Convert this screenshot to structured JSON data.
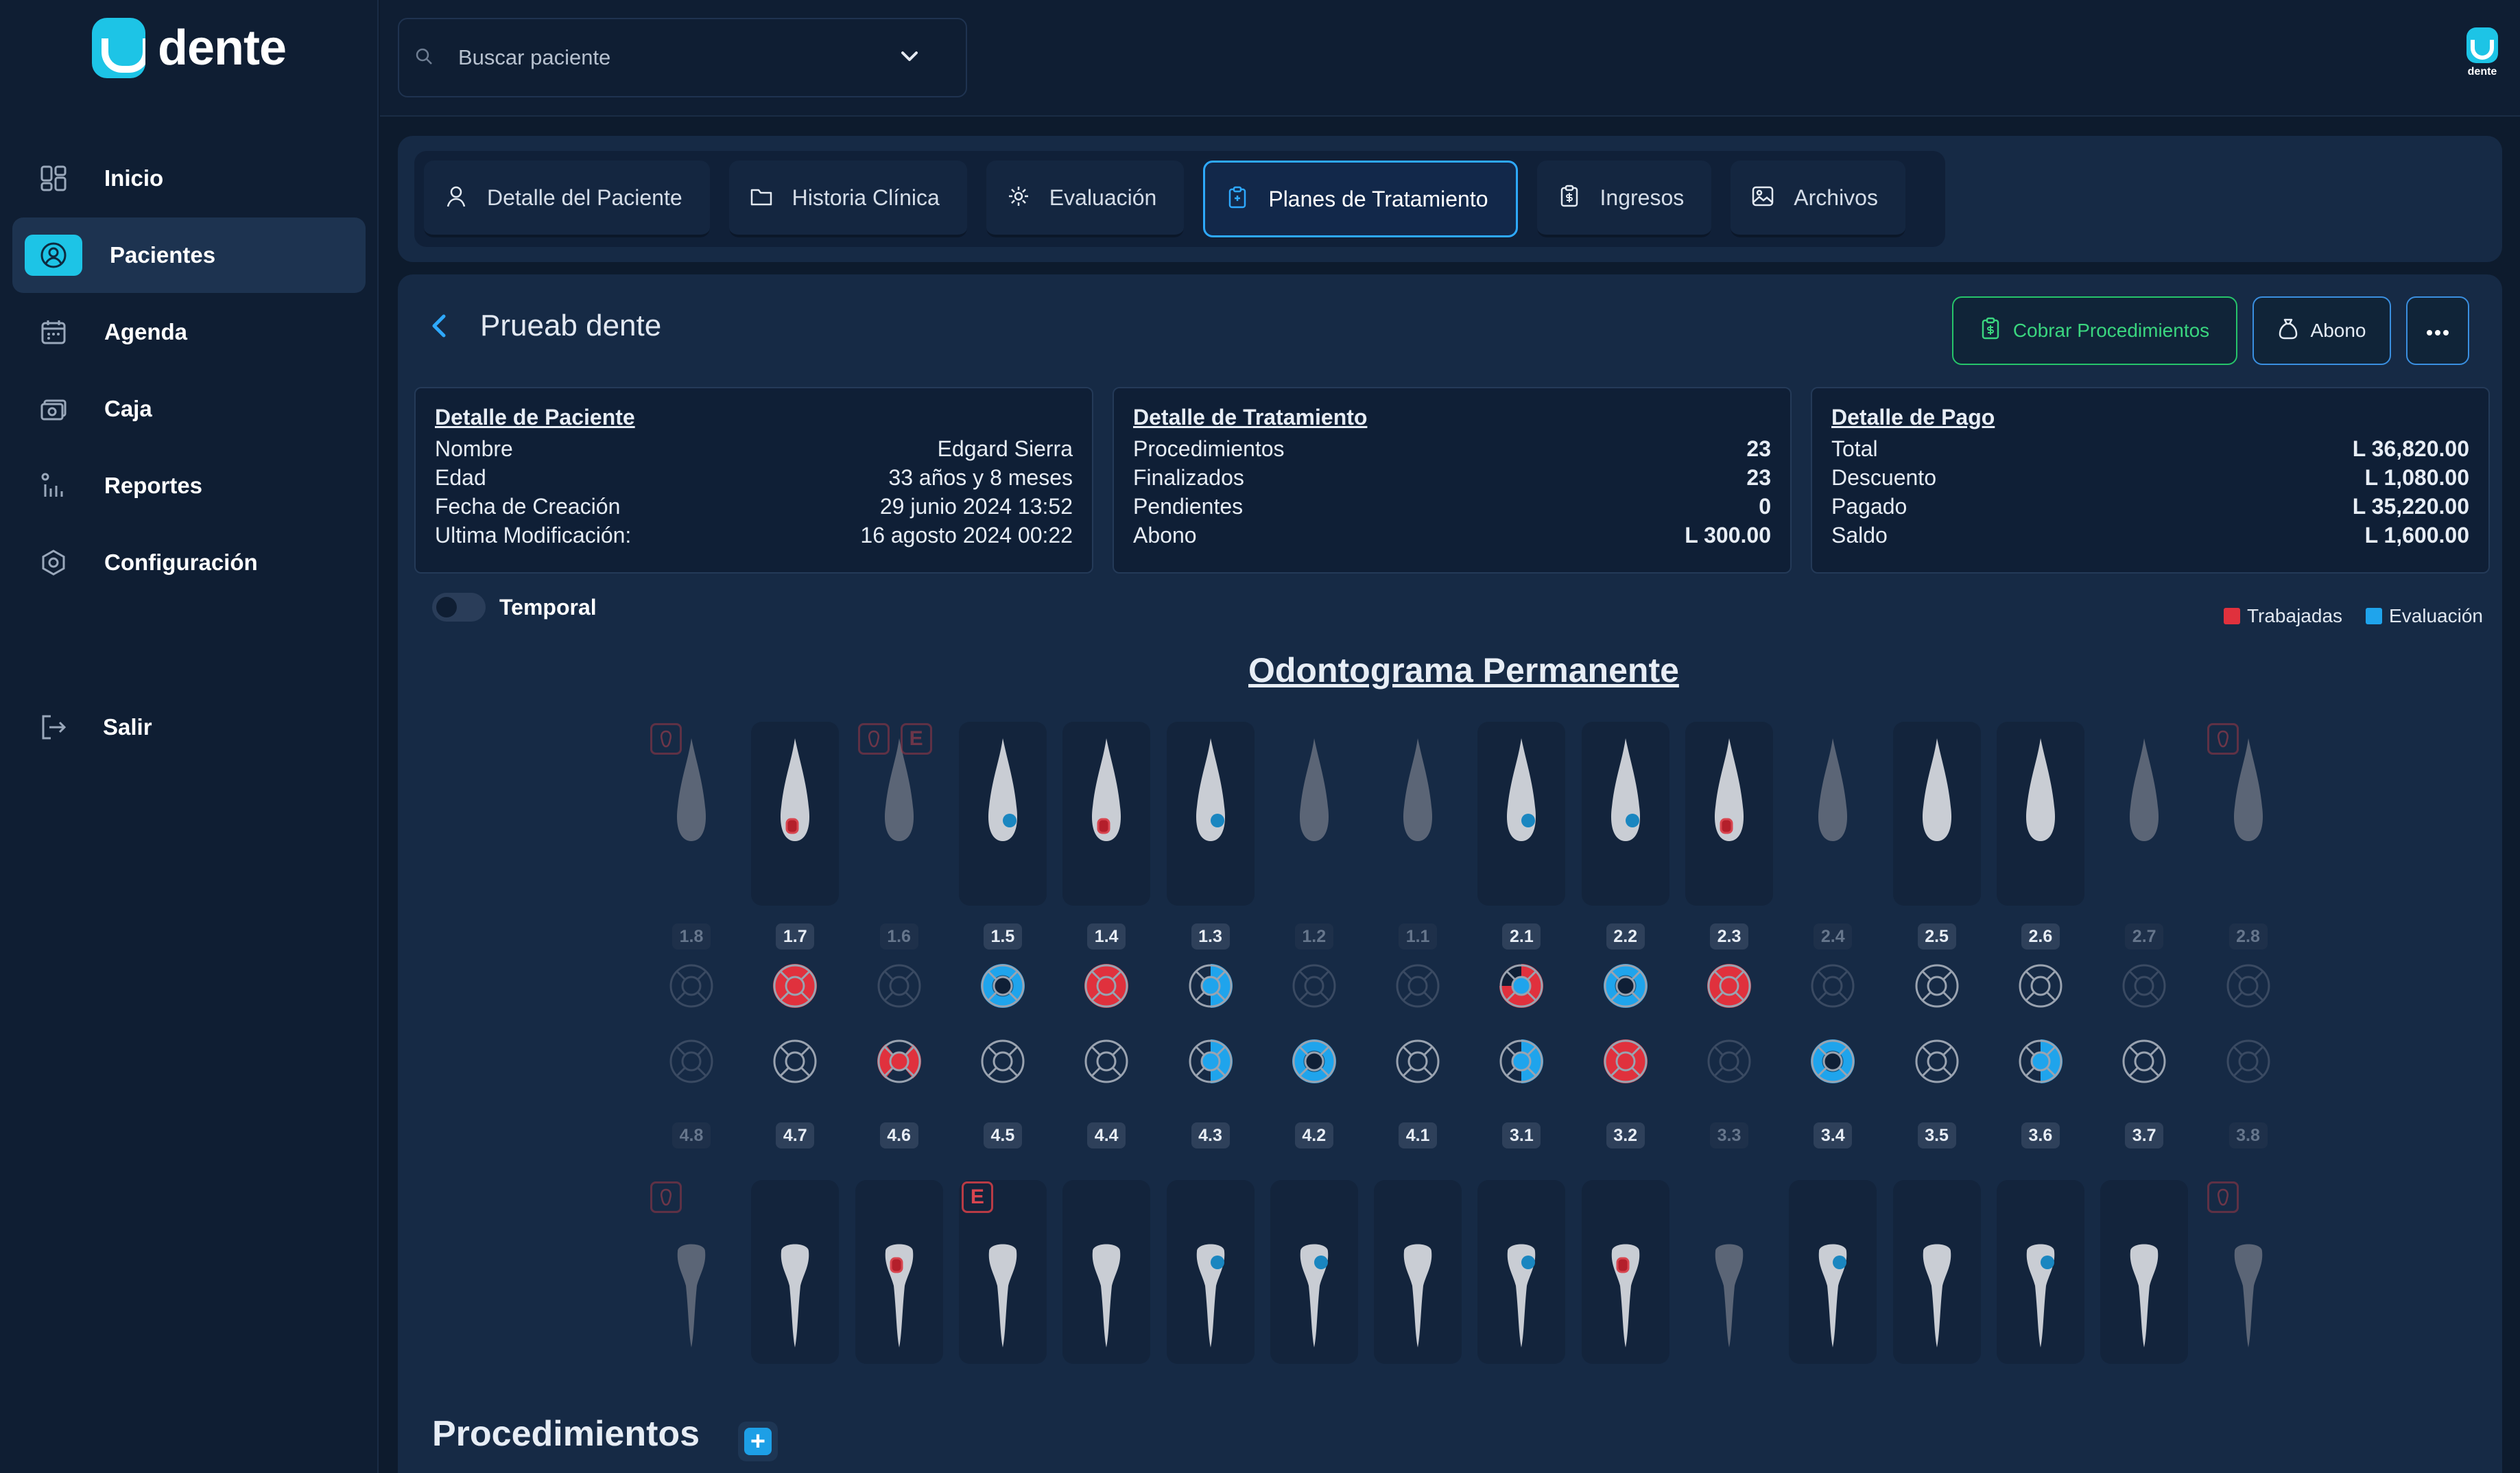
{
  "app": {
    "brand": "dente",
    "avatar_label": "dente"
  },
  "sidebar": {
    "items": [
      {
        "label": "Inicio",
        "icon": "dashboard-icon",
        "active": false
      },
      {
        "label": "Pacientes",
        "icon": "user-circle-icon",
        "active": true
      },
      {
        "label": "Agenda",
        "icon": "calendar-icon",
        "active": false
      },
      {
        "label": "Caja",
        "icon": "cash-register-icon",
        "active": false
      },
      {
        "label": "Reportes",
        "icon": "chart-icon",
        "active": false
      },
      {
        "label": "Configuración",
        "icon": "settings-icon",
        "active": false
      }
    ],
    "exit_label": "Salir"
  },
  "search": {
    "placeholder": "Buscar paciente"
  },
  "tabs": [
    {
      "label": "Detalle del Paciente",
      "icon": "user-icon",
      "active": false
    },
    {
      "label": "Historia Clínica",
      "icon": "folder-icon",
      "active": false
    },
    {
      "label": "Evaluación",
      "icon": "gear-icon",
      "active": false
    },
    {
      "label": "Planes de Tratamiento",
      "icon": "clipboard-icon",
      "active": true
    },
    {
      "label": "Ingresos",
      "icon": "invoice-icon",
      "active": false
    },
    {
      "label": "Archivos",
      "icon": "image-icon",
      "active": false
    }
  ],
  "patient": {
    "name": "Prueab dente"
  },
  "actions": {
    "charge": "Cobrar Procedimientos",
    "deposit": "Abono"
  },
  "cards": {
    "patient": {
      "title": "Detalle de Paciente",
      "rows": [
        {
          "label": "Nombre",
          "value": "Edgard Sierra"
        },
        {
          "label": "Edad",
          "value": "33 años y 8 meses"
        },
        {
          "label": "Fecha de Creación",
          "value": "29 junio 2024 13:52"
        },
        {
          "label": "Ultima Modificación:",
          "value": "16 agosto 2024 00:22"
        }
      ]
    },
    "treatment": {
      "title": "Detalle de Tratamiento",
      "rows": [
        {
          "label": "Procedimientos",
          "value": "23"
        },
        {
          "label": "Finalizados",
          "value": "23"
        },
        {
          "label": "Pendientes",
          "value": "0"
        },
        {
          "label": "Abono",
          "value": "L 300.00"
        }
      ]
    },
    "payment": {
      "title": "Detalle de Pago",
      "rows": [
        {
          "label": "Total",
          "value": "L 36,820.00"
        },
        {
          "label": "Descuento",
          "value": "L 1,080.00"
        },
        {
          "label": "Pagado",
          "value": "L 35,220.00"
        },
        {
          "label": "Saldo",
          "value": "L 1,600.00"
        }
      ]
    }
  },
  "toggle": {
    "label": "Temporal",
    "on": false
  },
  "legend": [
    {
      "label": "Trabajadas",
      "color": "#e0313d"
    },
    {
      "label": "Evaluación",
      "color": "#1fa4ec"
    }
  ],
  "odontogram": {
    "title": "Odontograma Permanente",
    "colors": {
      "worked": "#e0313d",
      "evaluation": "#1fa4ec",
      "tooth": "#c9cdd4",
      "tooth_dim": "#5b6576"
    },
    "upper": [
      {
        "num": "1.8",
        "present": false,
        "flags": [
          "extraction"
        ],
        "surface": "none"
      },
      {
        "num": "1.7",
        "present": true,
        "flags": [],
        "surface": "red-full"
      },
      {
        "num": "1.6",
        "present": false,
        "flags": [
          "extraction",
          "E"
        ],
        "surface": "none"
      },
      {
        "num": "1.5",
        "present": true,
        "flags": [],
        "surface": "blue-ring"
      },
      {
        "num": "1.4",
        "present": true,
        "flags": [],
        "surface": "red-full"
      },
      {
        "num": "1.3",
        "present": true,
        "flags": [],
        "surface": "blue-partial"
      },
      {
        "num": "1.2",
        "present": false,
        "flags": [],
        "surface": "none"
      },
      {
        "num": "1.1",
        "present": false,
        "flags": [],
        "surface": "none"
      },
      {
        "num": "2.1",
        "present": true,
        "flags": [],
        "surface": "mixed"
      },
      {
        "num": "2.2",
        "present": true,
        "flags": [],
        "surface": "blue-ring"
      },
      {
        "num": "2.3",
        "present": true,
        "flags": [],
        "surface": "red-full"
      },
      {
        "num": "2.4",
        "present": false,
        "flags": [],
        "surface": "none"
      },
      {
        "num": "2.5",
        "present": true,
        "flags": [],
        "surface": "empty"
      },
      {
        "num": "2.6",
        "present": true,
        "flags": [],
        "surface": "empty"
      },
      {
        "num": "2.7",
        "present": false,
        "flags": [],
        "surface": "none"
      },
      {
        "num": "2.8",
        "present": false,
        "flags": [
          "extraction"
        ],
        "surface": "none"
      }
    ],
    "lower": [
      {
        "num": "4.8",
        "present": false,
        "flags": [
          "extraction"
        ],
        "surface": "none"
      },
      {
        "num": "4.7",
        "present": true,
        "flags": [],
        "surface": "empty"
      },
      {
        "num": "4.6",
        "present": true,
        "flags": [],
        "surface": "red-sides"
      },
      {
        "num": "4.5",
        "present": true,
        "flags": [
          "E"
        ],
        "surface": "empty"
      },
      {
        "num": "4.4",
        "present": true,
        "flags": [],
        "surface": "empty"
      },
      {
        "num": "4.3",
        "present": true,
        "flags": [],
        "surface": "blue-partial"
      },
      {
        "num": "4.2",
        "present": true,
        "flags": [],
        "surface": "blue-ring"
      },
      {
        "num": "4.1",
        "present": true,
        "flags": [],
        "surface": "empty"
      },
      {
        "num": "3.1",
        "present": true,
        "flags": [],
        "surface": "blue-partial"
      },
      {
        "num": "3.2",
        "present": true,
        "flags": [],
        "surface": "red-full"
      },
      {
        "num": "3.3",
        "present": false,
        "flags": [],
        "surface": "none"
      },
      {
        "num": "3.4",
        "present": true,
        "flags": [],
        "surface": "blue-ring"
      },
      {
        "num": "3.5",
        "present": true,
        "flags": [],
        "surface": "empty"
      },
      {
        "num": "3.6",
        "present": true,
        "flags": [],
        "surface": "blue-partial"
      },
      {
        "num": "3.7",
        "present": true,
        "flags": [],
        "surface": "empty"
      },
      {
        "num": "3.8",
        "present": false,
        "flags": [
          "extraction"
        ],
        "surface": "none"
      }
    ]
  },
  "procedures": {
    "title": "Procedimientos"
  }
}
